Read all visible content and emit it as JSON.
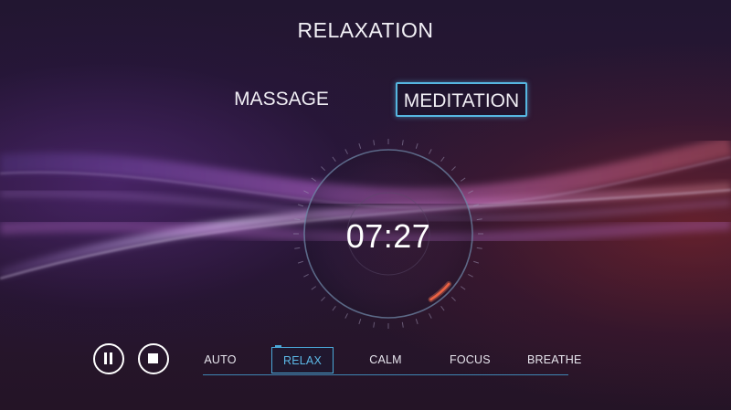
{
  "screen": {
    "title": "RELAXATION"
  },
  "modes": {
    "items": [
      {
        "label": "MASSAGE",
        "selected": false
      },
      {
        "label": "MEDITATION",
        "selected": true
      }
    ]
  },
  "timer": {
    "display": "07:27"
  },
  "controls": {
    "pause_icon": "pause-icon",
    "stop_icon": "stop-icon"
  },
  "presets": {
    "items": [
      {
        "label": "AUTO",
        "selected": false
      },
      {
        "label": "RELAX",
        "selected": true
      },
      {
        "label": "CALM",
        "selected": false
      },
      {
        "label": "FOCUS",
        "selected": false
      },
      {
        "label": "BREATHE",
        "selected": false
      }
    ]
  },
  "colors": {
    "accent": "#56b6e0",
    "progress_arc": "#e0533a",
    "background": "#241631"
  }
}
